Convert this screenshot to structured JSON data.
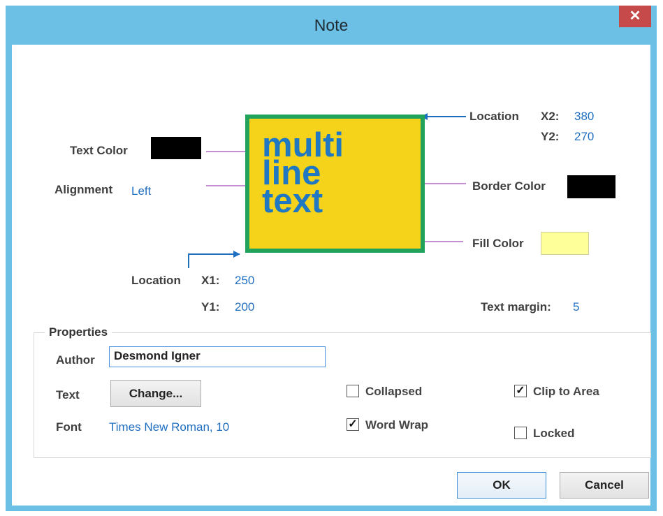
{
  "window": {
    "title": "Note",
    "close_glyph": "✕"
  },
  "diagram": {
    "text_color_label": "Text Color",
    "text_color": "#000000",
    "alignment_label": "Alignment",
    "alignment_value": "Left",
    "note_text": [
      "multi",
      "line",
      "text"
    ],
    "location_top_label": "Location",
    "x2_label": "X2:",
    "x2_value": "380",
    "y2_label": "Y2:",
    "y2_value": "270",
    "border_color_label": "Border Color",
    "border_color": "#000000",
    "fill_color_label": "Fill Color",
    "fill_color": "#ffff99",
    "location_bottom_label": "Location",
    "x1_label": "X1:",
    "x1_value": "250",
    "y1_label": "Y1:",
    "y1_value": "200",
    "text_margin_label": "Text margin:",
    "text_margin_value": "5",
    "note_fill": "#f4d31a",
    "note_border": "#21a35b",
    "note_text_color": "#1f78c1"
  },
  "properties": {
    "legend": "Properties",
    "author_label": "Author",
    "author_value": "Desmond Igner",
    "text_label": "Text",
    "change_button": "Change...",
    "font_label": "Font",
    "font_value": "Times New Roman, 10",
    "collapsed_label": "Collapsed",
    "collapsed_checked": false,
    "word_wrap_label": "Word Wrap",
    "word_wrap_checked": true,
    "clip_to_area_label": "Clip to Area",
    "clip_to_area_checked": true,
    "locked_label": "Locked",
    "locked_checked": false,
    "check_glyph": "✓"
  },
  "buttons": {
    "ok": "OK",
    "cancel": "Cancel"
  },
  "icons": {
    "close": "close-icon",
    "arrow": "arrow-icon",
    "check": "checkmark-icon"
  }
}
